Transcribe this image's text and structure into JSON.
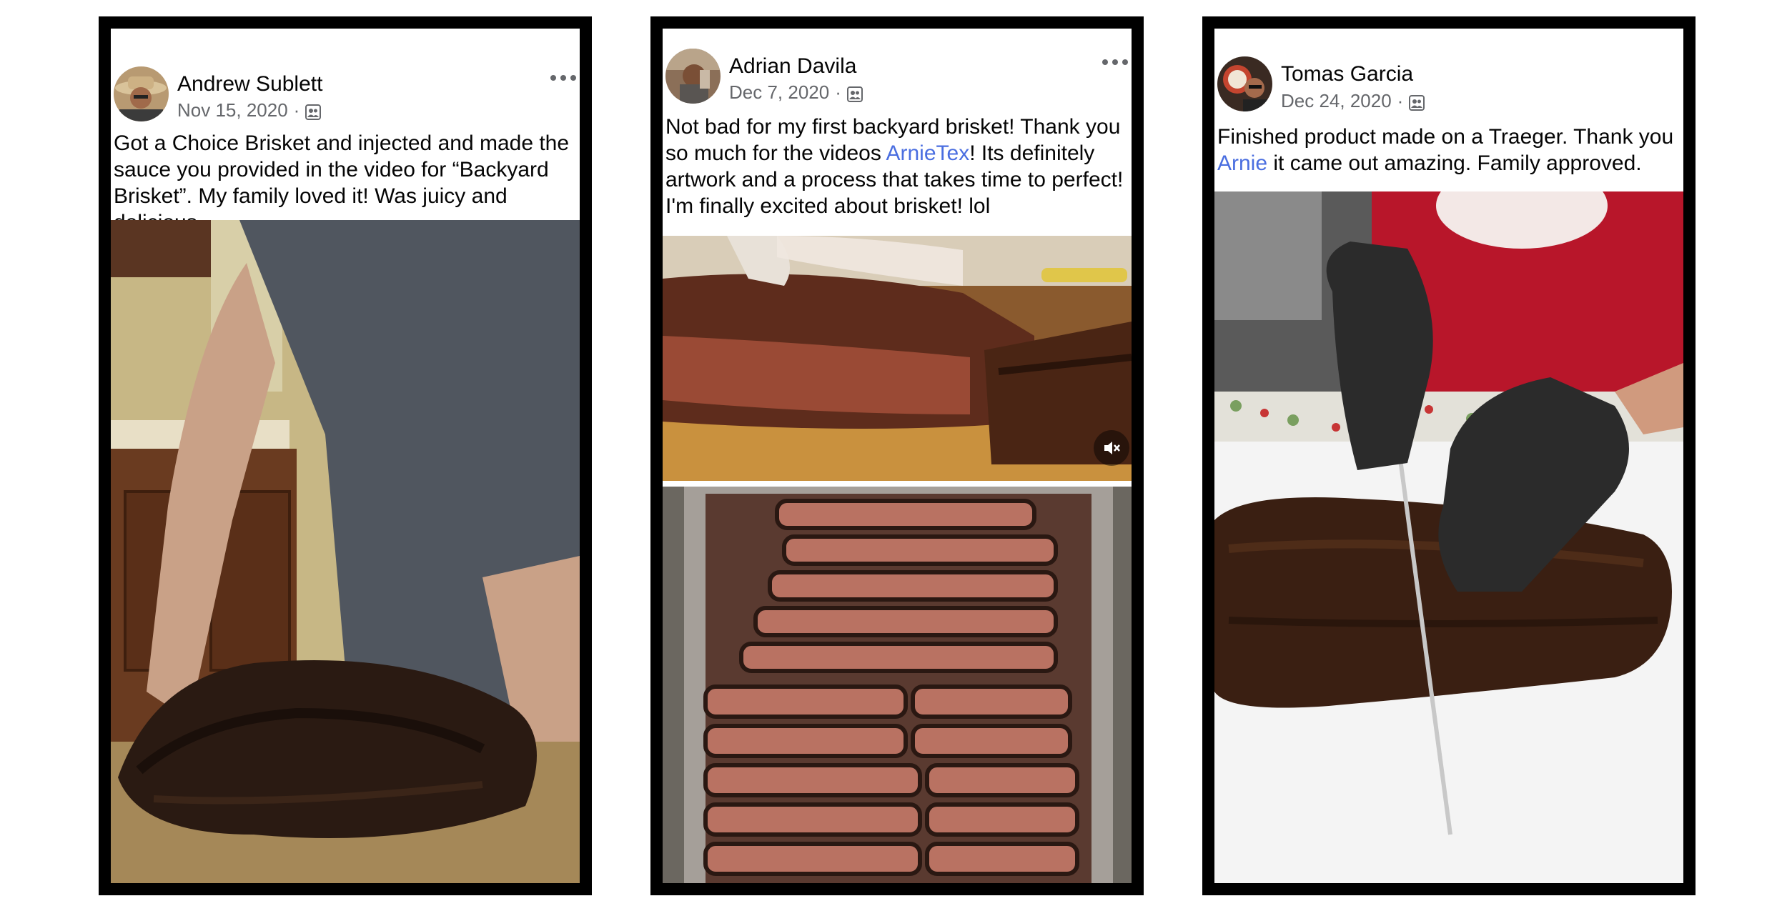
{
  "posts": [
    {
      "author": "Andrew Sublett",
      "date": "Nov 15, 2020",
      "separator": "·",
      "caption": "Got a Choice Brisket and injected and made the sauce you provided in the video for “Backyard Brisket”. My family loved it! Was juicy and delicious.",
      "photo_description_icon": "photo"
    },
    {
      "author": "Adrian Davila",
      "date": "Dec 7, 2020",
      "separator": "·",
      "caption_before": "Not bad for my first backyard brisket!  Thank you so much for the videos ",
      "caption_mention": "ArnieTex",
      "caption_after": "!  Its definitely artwork and a process that takes time to perfect! I'm finally excited about brisket! lol"
    },
    {
      "author": "Tomas Garcia",
      "date": "Dec 24, 2020",
      "separator": "·",
      "caption_before": "Finished product made on a Traeger. Thank you ",
      "caption_mention": "Arnie",
      "caption_after": " it came out amazing. Family approved."
    }
  ],
  "icons": {
    "audience": "friends-icon",
    "more": "more-options-icon",
    "mute": "muted-speaker-icon"
  },
  "colors": {
    "mention": "#4a6ee0",
    "meta": "#65676b",
    "frame": "#000000"
  }
}
